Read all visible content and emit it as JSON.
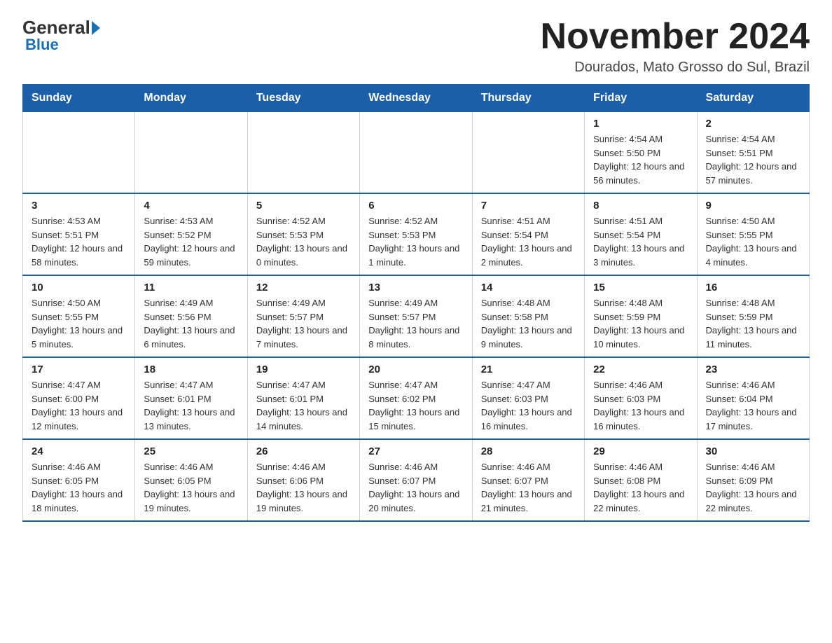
{
  "logo": {
    "text_general": "General",
    "text_blue": "Blue",
    "subtitle": "Blue"
  },
  "header": {
    "title": "November 2024",
    "location": "Dourados, Mato Grosso do Sul, Brazil"
  },
  "weekdays": [
    "Sunday",
    "Monday",
    "Tuesday",
    "Wednesday",
    "Thursday",
    "Friday",
    "Saturday"
  ],
  "weeks": [
    [
      {
        "day": "",
        "sunrise": "",
        "sunset": "",
        "daylight": ""
      },
      {
        "day": "",
        "sunrise": "",
        "sunset": "",
        "daylight": ""
      },
      {
        "day": "",
        "sunrise": "",
        "sunset": "",
        "daylight": ""
      },
      {
        "day": "",
        "sunrise": "",
        "sunset": "",
        "daylight": ""
      },
      {
        "day": "",
        "sunrise": "",
        "sunset": "",
        "daylight": ""
      },
      {
        "day": "1",
        "sunrise": "Sunrise: 4:54 AM",
        "sunset": "Sunset: 5:50 PM",
        "daylight": "Daylight: 12 hours and 56 minutes."
      },
      {
        "day": "2",
        "sunrise": "Sunrise: 4:54 AM",
        "sunset": "Sunset: 5:51 PM",
        "daylight": "Daylight: 12 hours and 57 minutes."
      }
    ],
    [
      {
        "day": "3",
        "sunrise": "Sunrise: 4:53 AM",
        "sunset": "Sunset: 5:51 PM",
        "daylight": "Daylight: 12 hours and 58 minutes."
      },
      {
        "day": "4",
        "sunrise": "Sunrise: 4:53 AM",
        "sunset": "Sunset: 5:52 PM",
        "daylight": "Daylight: 12 hours and 59 minutes."
      },
      {
        "day": "5",
        "sunrise": "Sunrise: 4:52 AM",
        "sunset": "Sunset: 5:53 PM",
        "daylight": "Daylight: 13 hours and 0 minutes."
      },
      {
        "day": "6",
        "sunrise": "Sunrise: 4:52 AM",
        "sunset": "Sunset: 5:53 PM",
        "daylight": "Daylight: 13 hours and 1 minute."
      },
      {
        "day": "7",
        "sunrise": "Sunrise: 4:51 AM",
        "sunset": "Sunset: 5:54 PM",
        "daylight": "Daylight: 13 hours and 2 minutes."
      },
      {
        "day": "8",
        "sunrise": "Sunrise: 4:51 AM",
        "sunset": "Sunset: 5:54 PM",
        "daylight": "Daylight: 13 hours and 3 minutes."
      },
      {
        "day": "9",
        "sunrise": "Sunrise: 4:50 AM",
        "sunset": "Sunset: 5:55 PM",
        "daylight": "Daylight: 13 hours and 4 minutes."
      }
    ],
    [
      {
        "day": "10",
        "sunrise": "Sunrise: 4:50 AM",
        "sunset": "Sunset: 5:55 PM",
        "daylight": "Daylight: 13 hours and 5 minutes."
      },
      {
        "day": "11",
        "sunrise": "Sunrise: 4:49 AM",
        "sunset": "Sunset: 5:56 PM",
        "daylight": "Daylight: 13 hours and 6 minutes."
      },
      {
        "day": "12",
        "sunrise": "Sunrise: 4:49 AM",
        "sunset": "Sunset: 5:57 PM",
        "daylight": "Daylight: 13 hours and 7 minutes."
      },
      {
        "day": "13",
        "sunrise": "Sunrise: 4:49 AM",
        "sunset": "Sunset: 5:57 PM",
        "daylight": "Daylight: 13 hours and 8 minutes."
      },
      {
        "day": "14",
        "sunrise": "Sunrise: 4:48 AM",
        "sunset": "Sunset: 5:58 PM",
        "daylight": "Daylight: 13 hours and 9 minutes."
      },
      {
        "day": "15",
        "sunrise": "Sunrise: 4:48 AM",
        "sunset": "Sunset: 5:59 PM",
        "daylight": "Daylight: 13 hours and 10 minutes."
      },
      {
        "day": "16",
        "sunrise": "Sunrise: 4:48 AM",
        "sunset": "Sunset: 5:59 PM",
        "daylight": "Daylight: 13 hours and 11 minutes."
      }
    ],
    [
      {
        "day": "17",
        "sunrise": "Sunrise: 4:47 AM",
        "sunset": "Sunset: 6:00 PM",
        "daylight": "Daylight: 13 hours and 12 minutes."
      },
      {
        "day": "18",
        "sunrise": "Sunrise: 4:47 AM",
        "sunset": "Sunset: 6:01 PM",
        "daylight": "Daylight: 13 hours and 13 minutes."
      },
      {
        "day": "19",
        "sunrise": "Sunrise: 4:47 AM",
        "sunset": "Sunset: 6:01 PM",
        "daylight": "Daylight: 13 hours and 14 minutes."
      },
      {
        "day": "20",
        "sunrise": "Sunrise: 4:47 AM",
        "sunset": "Sunset: 6:02 PM",
        "daylight": "Daylight: 13 hours and 15 minutes."
      },
      {
        "day": "21",
        "sunrise": "Sunrise: 4:47 AM",
        "sunset": "Sunset: 6:03 PM",
        "daylight": "Daylight: 13 hours and 16 minutes."
      },
      {
        "day": "22",
        "sunrise": "Sunrise: 4:46 AM",
        "sunset": "Sunset: 6:03 PM",
        "daylight": "Daylight: 13 hours and 16 minutes."
      },
      {
        "day": "23",
        "sunrise": "Sunrise: 4:46 AM",
        "sunset": "Sunset: 6:04 PM",
        "daylight": "Daylight: 13 hours and 17 minutes."
      }
    ],
    [
      {
        "day": "24",
        "sunrise": "Sunrise: 4:46 AM",
        "sunset": "Sunset: 6:05 PM",
        "daylight": "Daylight: 13 hours and 18 minutes."
      },
      {
        "day": "25",
        "sunrise": "Sunrise: 4:46 AM",
        "sunset": "Sunset: 6:05 PM",
        "daylight": "Daylight: 13 hours and 19 minutes."
      },
      {
        "day": "26",
        "sunrise": "Sunrise: 4:46 AM",
        "sunset": "Sunset: 6:06 PM",
        "daylight": "Daylight: 13 hours and 19 minutes."
      },
      {
        "day": "27",
        "sunrise": "Sunrise: 4:46 AM",
        "sunset": "Sunset: 6:07 PM",
        "daylight": "Daylight: 13 hours and 20 minutes."
      },
      {
        "day": "28",
        "sunrise": "Sunrise: 4:46 AM",
        "sunset": "Sunset: 6:07 PM",
        "daylight": "Daylight: 13 hours and 21 minutes."
      },
      {
        "day": "29",
        "sunrise": "Sunrise: 4:46 AM",
        "sunset": "Sunset: 6:08 PM",
        "daylight": "Daylight: 13 hours and 22 minutes."
      },
      {
        "day": "30",
        "sunrise": "Sunrise: 4:46 AM",
        "sunset": "Sunset: 6:09 PM",
        "daylight": "Daylight: 13 hours and 22 minutes."
      }
    ]
  ]
}
